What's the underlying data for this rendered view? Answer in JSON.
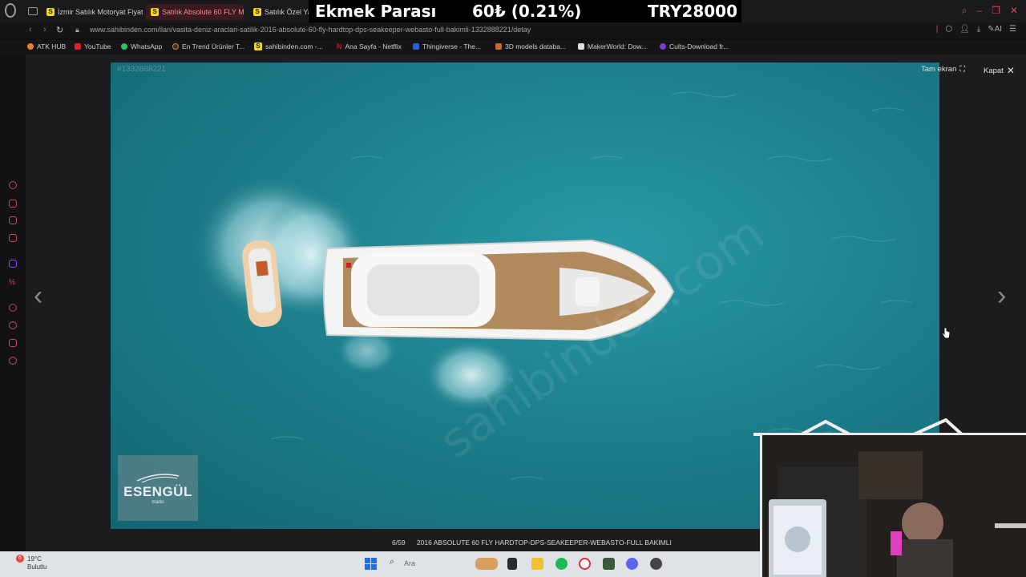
{
  "browser": {
    "tabs": [
      {
        "label": "İzmir Satılık Motoryat Fiyatl",
        "active": false
      },
      {
        "label": "Satılık Absolute 60 FLY Mo",
        "active": true
      },
      {
        "label": "Satılık Özel Yap",
        "active": false
      }
    ],
    "url": "www.sahibinden.com/ilan/vasita-deniz-araclari-satilik-2016-absolute-60-fly-hardtop-dps-seakeeper-webasto-full-bakimli-1332888221/detay",
    "bookmarks": [
      {
        "label": "ATK HUB",
        "icon": "orange-circle-icon"
      },
      {
        "label": "YouTube",
        "icon": "youtube-icon"
      },
      {
        "label": "WhatsApp",
        "icon": "whatsapp-icon"
      },
      {
        "label": "En Trend Ürünler T...",
        "icon": "trend-icon"
      },
      {
        "label": "sahibinden.com -...",
        "icon": "sahibinden-icon"
      },
      {
        "label": "Ana Sayfa - Netflix",
        "icon": "netflix-icon"
      },
      {
        "label": "Thingiverse - The...",
        "icon": "thingiverse-icon"
      },
      {
        "label": "3D models databa...",
        "icon": "3d-models-icon"
      },
      {
        "label": "MakerWorld: Dow...",
        "icon": "makerworld-icon"
      },
      {
        "label": "Cults-Download fr...",
        "icon": "cults-icon"
      }
    ]
  },
  "stream_overlay": {
    "title": "Ekmek Parası",
    "amount": "60₺ (0.21%)",
    "goal": "TRY28000"
  },
  "lightbox": {
    "photo_id": "#1332888221",
    "fullscreen_label": "Tam ekran",
    "close_label": "Kapat",
    "counter": "6/59",
    "caption": "2016 ABSOLUTE 60 FLY HARDTOP-DPS-SEAKEEPER-WEBASTO-FULL BAKIMLI",
    "watermark_logo": "ESENGÜL",
    "watermark_sub": "marin"
  },
  "taskbar": {
    "weather_temp": "19°C",
    "weather_desc": "Bulutlu",
    "weather_badge": "6",
    "search_label": "Ara"
  },
  "colors": {
    "accent": "#d0455a",
    "sea": "#1d7f8d",
    "active_tab_bg": "#3a1a1e"
  }
}
